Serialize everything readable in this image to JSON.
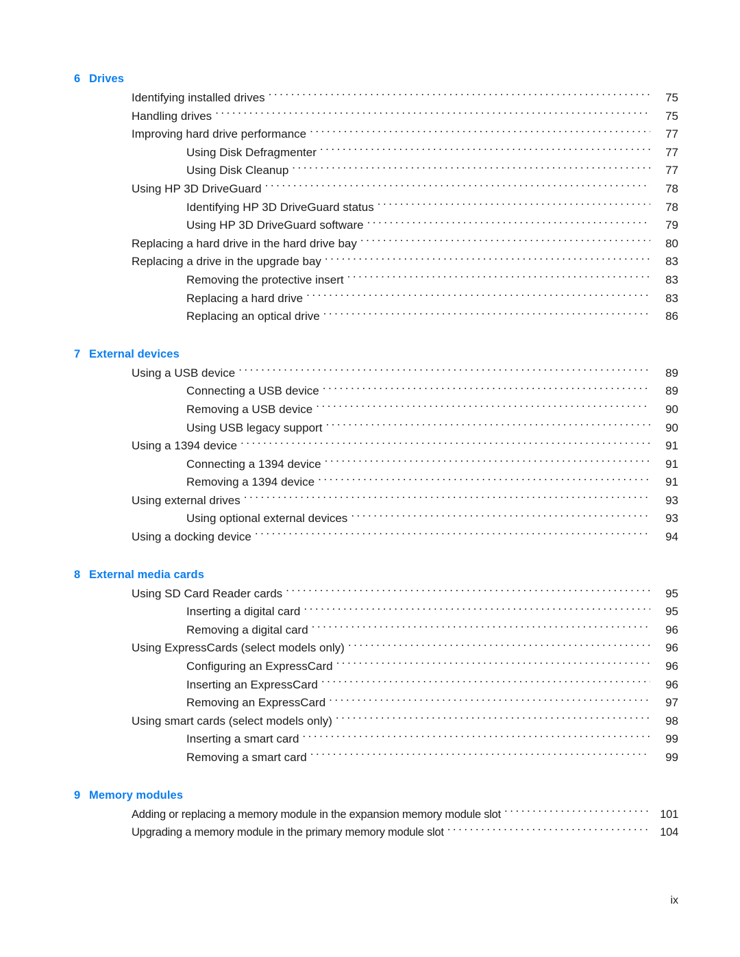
{
  "document": {
    "footer_page_label": "ix"
  },
  "toc": {
    "chapters": [
      {
        "number": "6",
        "title": "Drives",
        "entries": [
          {
            "level": 1,
            "label": "Identifying installed drives",
            "page": "75"
          },
          {
            "level": 1,
            "label": "Handling drives",
            "page": "75"
          },
          {
            "level": 1,
            "label": "Improving hard drive performance",
            "page": "77"
          },
          {
            "level": 2,
            "label": "Using Disk Defragmenter",
            "page": "77"
          },
          {
            "level": 2,
            "label": "Using Disk Cleanup",
            "page": "77"
          },
          {
            "level": 1,
            "label": "Using HP 3D DriveGuard",
            "page": "78"
          },
          {
            "level": 2,
            "label": "Identifying HP 3D DriveGuard status",
            "page": "78"
          },
          {
            "level": 2,
            "label": "Using HP 3D DriveGuard software",
            "page": "79"
          },
          {
            "level": 1,
            "label": "Replacing a hard drive in the hard drive bay",
            "page": "80"
          },
          {
            "level": 1,
            "label": "Replacing a drive in the upgrade bay",
            "page": "83"
          },
          {
            "level": 2,
            "label": "Removing the protective insert",
            "page": "83"
          },
          {
            "level": 2,
            "label": "Replacing a hard drive",
            "page": "83"
          },
          {
            "level": 2,
            "label": "Replacing an optical drive",
            "page": "86"
          }
        ]
      },
      {
        "number": "7",
        "title": "External devices",
        "entries": [
          {
            "level": 1,
            "label": "Using a USB device",
            "page": "89"
          },
          {
            "level": 2,
            "label": "Connecting a USB device",
            "page": "89"
          },
          {
            "level": 2,
            "label": "Removing a USB device",
            "page": "90"
          },
          {
            "level": 2,
            "label": "Using USB legacy support",
            "page": "90"
          },
          {
            "level": 1,
            "label": "Using a 1394 device",
            "page": "91"
          },
          {
            "level": 2,
            "label": "Connecting a 1394 device",
            "page": "91"
          },
          {
            "level": 2,
            "label": "Removing a 1394 device",
            "page": "91"
          },
          {
            "level": 1,
            "label": "Using external drives",
            "page": "93"
          },
          {
            "level": 2,
            "label": "Using optional external devices",
            "page": "93"
          },
          {
            "level": 1,
            "label": "Using a docking device",
            "page": "94"
          }
        ]
      },
      {
        "number": "8",
        "title": "External media cards",
        "entries": [
          {
            "level": 1,
            "label": "Using SD Card Reader cards",
            "page": "95"
          },
          {
            "level": 2,
            "label": "Inserting a digital card",
            "page": "95"
          },
          {
            "level": 2,
            "label": "Removing a digital card",
            "page": "96"
          },
          {
            "level": 1,
            "label": "Using ExpressCards (select models only)",
            "page": "96"
          },
          {
            "level": 2,
            "label": "Configuring an ExpressCard",
            "page": "96"
          },
          {
            "level": 2,
            "label": "Inserting an ExpressCard",
            "page": "96"
          },
          {
            "level": 2,
            "label": "Removing an ExpressCard",
            "page": "97"
          },
          {
            "level": 1,
            "label": "Using smart cards (select models only)",
            "page": "98"
          },
          {
            "level": 2,
            "label": "Inserting a smart card",
            "page": "99"
          },
          {
            "level": 2,
            "label": "Removing a smart card",
            "page": "99"
          }
        ]
      },
      {
        "number": "9",
        "title": "Memory modules",
        "condensed": true,
        "entries": [
          {
            "level": 1,
            "label": "Adding or replacing a memory module in the expansion memory module slot",
            "page": "101"
          },
          {
            "level": 1,
            "label": "Upgrading a memory module in the primary memory module slot",
            "page": "104"
          }
        ]
      }
    ]
  },
  "colors": {
    "heading_blue": "#0b7ef0",
    "body_text": "#1a1a1a",
    "page_background": "#ffffff"
  }
}
